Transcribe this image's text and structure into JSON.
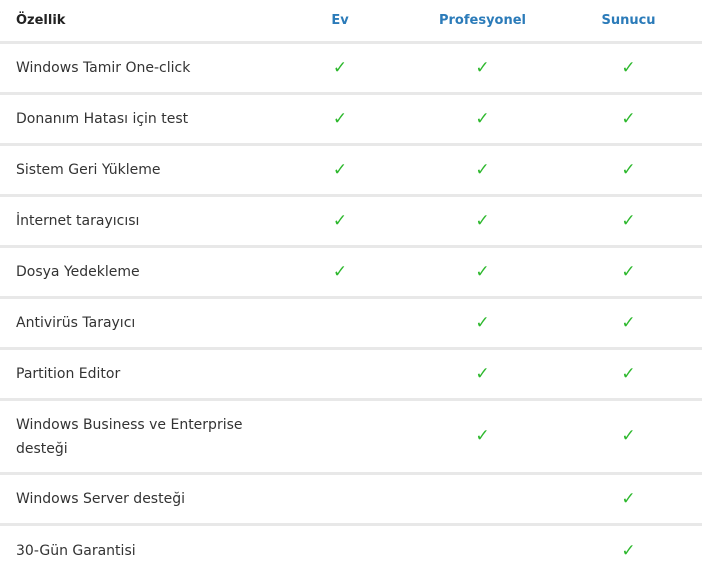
{
  "header": {
    "feature": "Özellik",
    "col1": "Ev",
    "col2": "Profesyonel",
    "col3": "Sunucu"
  },
  "check_glyph": "✓",
  "accent_color": "#2b7bb9",
  "check_color": "#2db82d",
  "rows": [
    {
      "feature": "Windows Tamir One-click",
      "ev": true,
      "pro": true,
      "sunucu": true
    },
    {
      "feature": "Donanım Hatası için test",
      "ev": true,
      "pro": true,
      "sunucu": true
    },
    {
      "feature": "Sistem Geri Yükleme",
      "ev": true,
      "pro": true,
      "sunucu": true
    },
    {
      "feature": "İnternet tarayıcısı",
      "ev": true,
      "pro": true,
      "sunucu": true
    },
    {
      "feature": "Dosya Yedekleme",
      "ev": true,
      "pro": true,
      "sunucu": true
    },
    {
      "feature": "Antivirüs Tarayıcı",
      "ev": false,
      "pro": true,
      "sunucu": true
    },
    {
      "feature": "Partition Editor",
      "ev": false,
      "pro": true,
      "sunucu": true
    },
    {
      "feature": "Windows Business ve Enterprise desteği",
      "ev": false,
      "pro": true,
      "sunucu": true
    },
    {
      "feature": "Windows Server desteği",
      "ev": false,
      "pro": false,
      "sunucu": true
    },
    {
      "feature": "30-Gün Garantisi",
      "ev": false,
      "pro": false,
      "sunucu": true
    }
  ]
}
